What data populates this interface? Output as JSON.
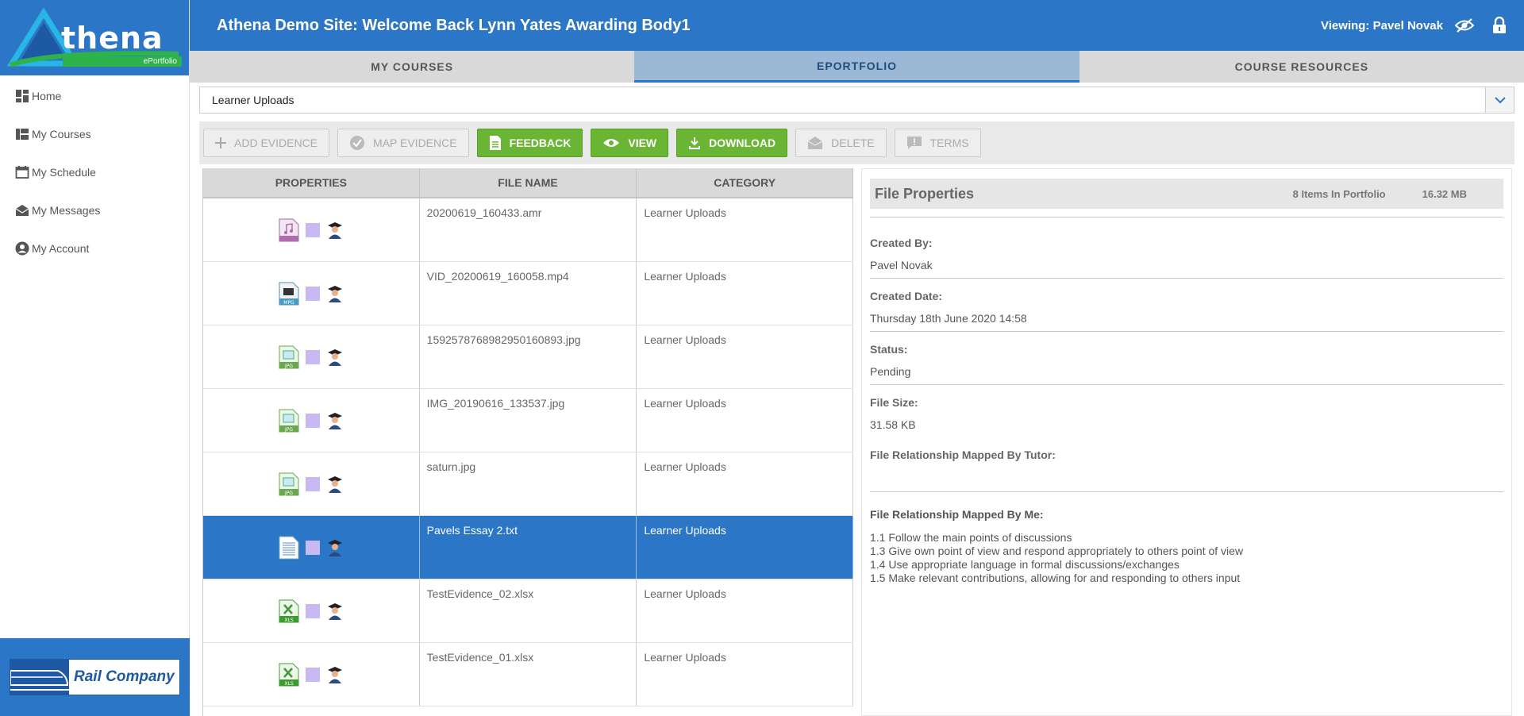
{
  "sidebar": {
    "logo_text": "thena",
    "logo_sub": "ePortfolio",
    "items": [
      {
        "label": "Home",
        "icon": "dashboard-icon"
      },
      {
        "label": "My Courses",
        "icon": "courses-icon"
      },
      {
        "label": "My Schedule",
        "icon": "calendar-icon"
      },
      {
        "label": "My Messages",
        "icon": "envelope-icon"
      },
      {
        "label": "My Account",
        "icon": "account-icon"
      }
    ],
    "footer_logo_text": "Rail Company"
  },
  "header": {
    "title": "Athena Demo Site: Welcome Back Lynn Yates Awarding Body1",
    "viewing": "Viewing: Pavel Novak"
  },
  "tabs": [
    {
      "label": "MY COURSES",
      "active": false
    },
    {
      "label": "EPORTFOLIO",
      "active": true
    },
    {
      "label": "COURSE RESOURCES",
      "active": false
    }
  ],
  "select": {
    "value": "Learner Uploads"
  },
  "toolbar": {
    "add_evidence": "ADD EVIDENCE",
    "map_evidence": "MAP EVIDENCE",
    "feedback": "FEEDBACK",
    "view": "VIEW",
    "download": "DOWNLOAD",
    "delete": "DELETE",
    "terms": "TERMS"
  },
  "table": {
    "columns": [
      "PROPERTIES",
      "FILE NAME",
      "CATEGORY"
    ],
    "rows": [
      {
        "file": "20200619_160433.amr",
        "category": "Learner Uploads",
        "type": "audio"
      },
      {
        "file": "VID_20200619_160058.mp4",
        "category": "Learner Uploads",
        "type": "mpg"
      },
      {
        "file": "1592578768982950160893.jpg",
        "category": "Learner Uploads",
        "type": "jpg"
      },
      {
        "file": "IMG_20190616_133537.jpg",
        "category": "Learner Uploads",
        "type": "jpg"
      },
      {
        "file": "saturn.jpg",
        "category": "Learner Uploads",
        "type": "jpg"
      },
      {
        "file": "Pavels Essay 2.txt",
        "category": "Learner Uploads",
        "type": "txt",
        "selected": true
      },
      {
        "file": "TestEvidence_02.xlsx",
        "category": "Learner Uploads",
        "type": "xls"
      },
      {
        "file": "TestEvidence_01.xlsx",
        "category": "Learner Uploads",
        "type": "xls"
      }
    ]
  },
  "properties": {
    "title": "File Properties",
    "items_count": "8 Items In Portfolio",
    "size_total": "16.32 MB",
    "created_by_label": "Created By:",
    "created_by": "Pavel Novak",
    "created_date_label": "Created Date:",
    "created_date": "Thursday 18th June 2020 14:58",
    "status_label": "Status:",
    "status": "Pending",
    "file_size_label": "File Size:",
    "file_size": "31.58 KB",
    "mapped_tutor_label": "File Relationship Mapped By Tutor:",
    "mapped_me_label": "File Relationship Mapped By Me:",
    "mapped_me": [
      "1.1 Follow the main points of discussions",
      "1.3 Give own point of view and respond appropriately to others point of view",
      "1.4 Use appropriate language in formal discussions/exchanges",
      "1.5 Make relevant contributions, allowing for and responding to others input"
    ]
  },
  "colors": {
    "brand_blue": "#2b76c6",
    "action_green": "#6bb534",
    "selected_row": "#2b76c6"
  }
}
